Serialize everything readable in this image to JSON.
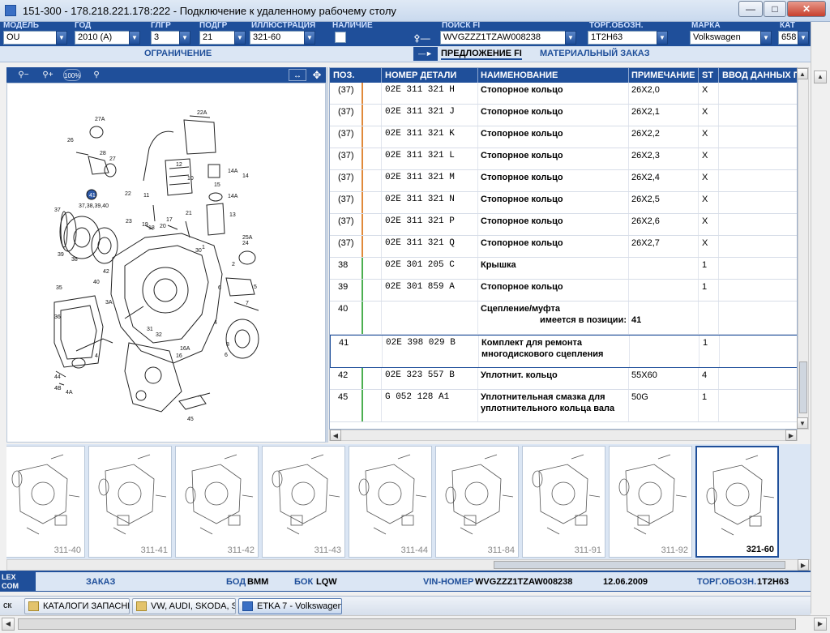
{
  "window": {
    "title": "151-300 - 178.218.221.178:222 - Подключение к удаленному рабочему столу",
    "minimize_icon": "minimize-icon",
    "maximize_icon": "maximize-icon",
    "close_icon": "close-icon"
  },
  "header": {
    "fields": [
      {
        "label": "МОДЕЛЬ",
        "value": "OU"
      },
      {
        "label": "ГОД",
        "value": "2010 (A)"
      },
      {
        "label": "ГЛГР",
        "value": "3"
      },
      {
        "label": "ПОДГР",
        "value": "21"
      },
      {
        "label": "ИЛЛЮСТРАЦИЯ",
        "value": "321-60"
      },
      {
        "label": "НАЛИЧИЕ",
        "value": ""
      },
      {
        "label": "ПОИСК FI",
        "value": "WVGZZZ1TZAW008238"
      },
      {
        "label": "ТОРГ.ОБОЗН.",
        "value": "1T2H63"
      },
      {
        "label": "МАРКА",
        "value": "Volkswagen"
      },
      {
        "label": "КАТ",
        "value": "658"
      }
    ]
  },
  "subbar": {
    "limit": "ОГРАНИЧЕНИЕ",
    "offer": "ПРЕДЛОЖЕНИЕ FI",
    "order": "МАТЕРИАЛЬНЫЙ ЗАКАЗ"
  },
  "image_toolbar": {
    "zoom_out_icon": "zoom-out-icon",
    "zoom_in_icon": "zoom-in-icon",
    "zoom_100": "100%",
    "search_icon": "magnifier-icon",
    "fit_icon": "fit-icon",
    "move_icon": "move-icon"
  },
  "diagram": {
    "callouts": [
      "27A",
      "22A",
      "26",
      "28",
      "27",
      "12",
      "14A",
      "14",
      "10",
      "15",
      "11",
      "14A",
      "13",
      "22",
      "41",
      "37,38,39,40",
      "21",
      "23",
      "17",
      "19",
      "20",
      "18",
      "37",
      "25A",
      "24",
      "1",
      "30",
      "2",
      "5",
      "6",
      "7",
      "3A",
      "4",
      "41",
      "35",
      "36",
      "31",
      "32",
      "16A",
      "8",
      "16",
      "6",
      "4B",
      "4A",
      "45",
      "44",
      "39",
      "38",
      "42",
      "29"
    ]
  },
  "table": {
    "columns": [
      "ПОЗ.",
      "НОМЕР ДЕТАЛИ",
      "НАИМЕНОВАНИЕ",
      "ПРИМЕЧАНИЕ",
      "ST",
      "ВВОД ДАННЫХ ПО"
    ],
    "rows": [
      {
        "pos": "(37)",
        "part": "02E  311  321  H",
        "name": "Стопорное кольцо",
        "note": "26X2,0",
        "st": "X",
        "stripe": "#e0893a"
      },
      {
        "pos": "(37)",
        "part": "02E  311  321  J",
        "name": "Стопорное кольцо",
        "note": "26X2,1",
        "st": "X",
        "stripe": "#e0893a"
      },
      {
        "pos": "(37)",
        "part": "02E  311  321  K",
        "name": "Стопорное кольцо",
        "note": "26X2,2",
        "st": "X",
        "stripe": "#e0893a"
      },
      {
        "pos": "(37)",
        "part": "02E  311  321  L",
        "name": "Стопорное кольцо",
        "note": "26X2,3",
        "st": "X",
        "stripe": "#e0893a"
      },
      {
        "pos": "(37)",
        "part": "02E  311  321  M",
        "name": "Стопорное кольцо",
        "note": "26X2,4",
        "st": "X",
        "stripe": "#e0893a"
      },
      {
        "pos": "(37)",
        "part": "02E  311  321  N",
        "name": "Стопорное кольцо",
        "note": "26X2,5",
        "st": "X",
        "stripe": "#e0893a"
      },
      {
        "pos": "(37)",
        "part": "02E  311  321  P",
        "name": "Стопорное кольцо",
        "note": "26X2,6",
        "st": "X",
        "stripe": "#e0893a"
      },
      {
        "pos": "(37)",
        "part": "02E  311  321  Q",
        "name": "Стопорное кольцо",
        "note": "26X2,7",
        "st": "X",
        "stripe": "#e0893a"
      },
      {
        "pos": "38",
        "part": "02E  301  205  C",
        "name": "Крышка",
        "note": "",
        "st": "1",
        "stripe": "#4caf50"
      },
      {
        "pos": "39",
        "part": "02E  301  859  A",
        "name": "Стопорное кольцо",
        "note": "",
        "st": "1",
        "stripe": "#4caf50"
      },
      {
        "pos": "40",
        "part": "",
        "name": "Сцепление/муфта",
        "name2": "имеется в позиции:",
        "note": "41",
        "st": "",
        "stripe": "#4caf50"
      },
      {
        "pos": "41",
        "part": "02E  398  029  B",
        "name": "Комплект для ремонта",
        "name2": "многодискового сцепления",
        "note": "",
        "st": "1",
        "stripe": "#ffffff"
      },
      {
        "pos": "42",
        "part": "02E  323  557  B",
        "name": "Уплотнит. кольцо",
        "note": "55X60",
        "st": "4",
        "stripe": "#4caf50"
      },
      {
        "pos": "45",
        "part": "G    052  128  A1",
        "name": "Уплотнительная смазка для",
        "name2": "уплотнительного кольца вала",
        "note": "50G",
        "st": "1",
        "stripe": "#4caf50"
      }
    ]
  },
  "thumbnails": [
    "311-40",
    "311-41",
    "311-42",
    "311-43",
    "311-44",
    "311-84",
    "311-91",
    "311-92",
    "321-60"
  ],
  "statusbar": {
    "logo": "LEX COM",
    "order_label": "ЗАКАЗ",
    "bod_label": "БОД",
    "bod_value": "BMM",
    "bok_label": "БОК",
    "bok_value": "LQW",
    "vin_label": "VIN-НОМЕР",
    "vin_value": "WVGZZZ1TZAW008238",
    "date": "12.06.2009",
    "torg_label": "ТОРГ.ОБОЗН.",
    "torg_value": "1T2H63"
  },
  "taskbar": {
    "start_text": "ск",
    "items": [
      "КАТАЛОГИ ЗАПАСНЫХ ...",
      "VW, AUDI, SKODA, SEAT",
      "ETKA 7 - Volkswagen"
    ]
  },
  "colors": {
    "brand_blue": "#1f4f9a",
    "orange_stripe": "#e0893a",
    "green_stripe": "#4caf50"
  }
}
